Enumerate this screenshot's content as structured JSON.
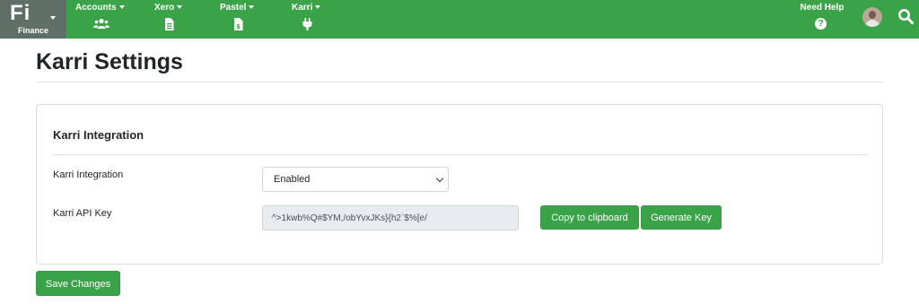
{
  "brand": {
    "logo_text": "Fi",
    "subtitle": "Finance"
  },
  "nav": {
    "items": [
      {
        "label": "Accounts",
        "icon": "users-icon"
      },
      {
        "label": "Xero",
        "icon": "document-icon"
      },
      {
        "label": "Pastel",
        "icon": "invoice-icon"
      },
      {
        "label": "Karri",
        "icon": "plug-icon"
      }
    ],
    "help_label": "Need Help",
    "help_icon": "question-circle-icon"
  },
  "page": {
    "title": "Karri Settings"
  },
  "card": {
    "title": "Karri Integration",
    "integration_label": "Karri Integration",
    "integration_value": "Enabled",
    "api_key_label": "Karri API Key",
    "api_key_value": "^>1kwb%Q#$YM,/obYvxJKs}{h2`$%[e/",
    "copy_label": "Copy to clipboard",
    "generate_label": "Generate Key"
  },
  "footer": {
    "save_label": "Save Changes"
  },
  "colors": {
    "accent": "#3aa348",
    "brand_bg": "#5f6e66"
  }
}
